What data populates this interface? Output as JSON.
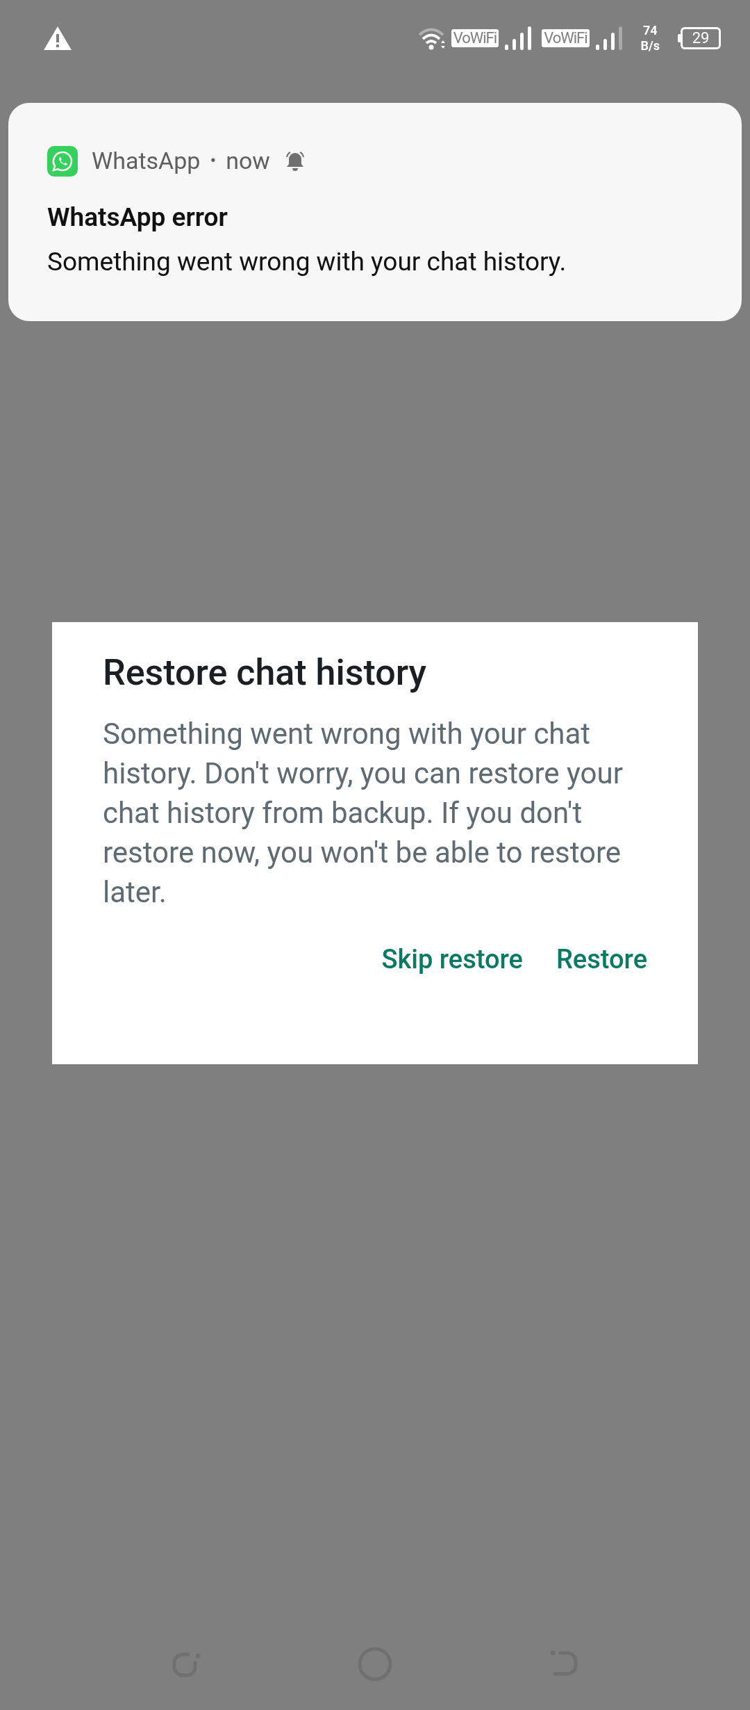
{
  "status_bar": {
    "vowifi_labels": [
      "VoWiFi",
      "VoWiFi"
    ],
    "net_speed_value": "74",
    "net_speed_unit": "B/s",
    "battery": "29"
  },
  "notification": {
    "app": "WhatsApp",
    "separator": "•",
    "time": "now",
    "title": "WhatsApp error",
    "body": "Something went wrong with your chat history."
  },
  "dialog": {
    "title": "Restore chat history",
    "message": "Something went wrong with your chat history. Don't worry, you can restore your chat history from backup. If you don't restore now, you won't be able to restore later.",
    "buttons": [
      "Skip restore",
      "Restore"
    ]
  }
}
